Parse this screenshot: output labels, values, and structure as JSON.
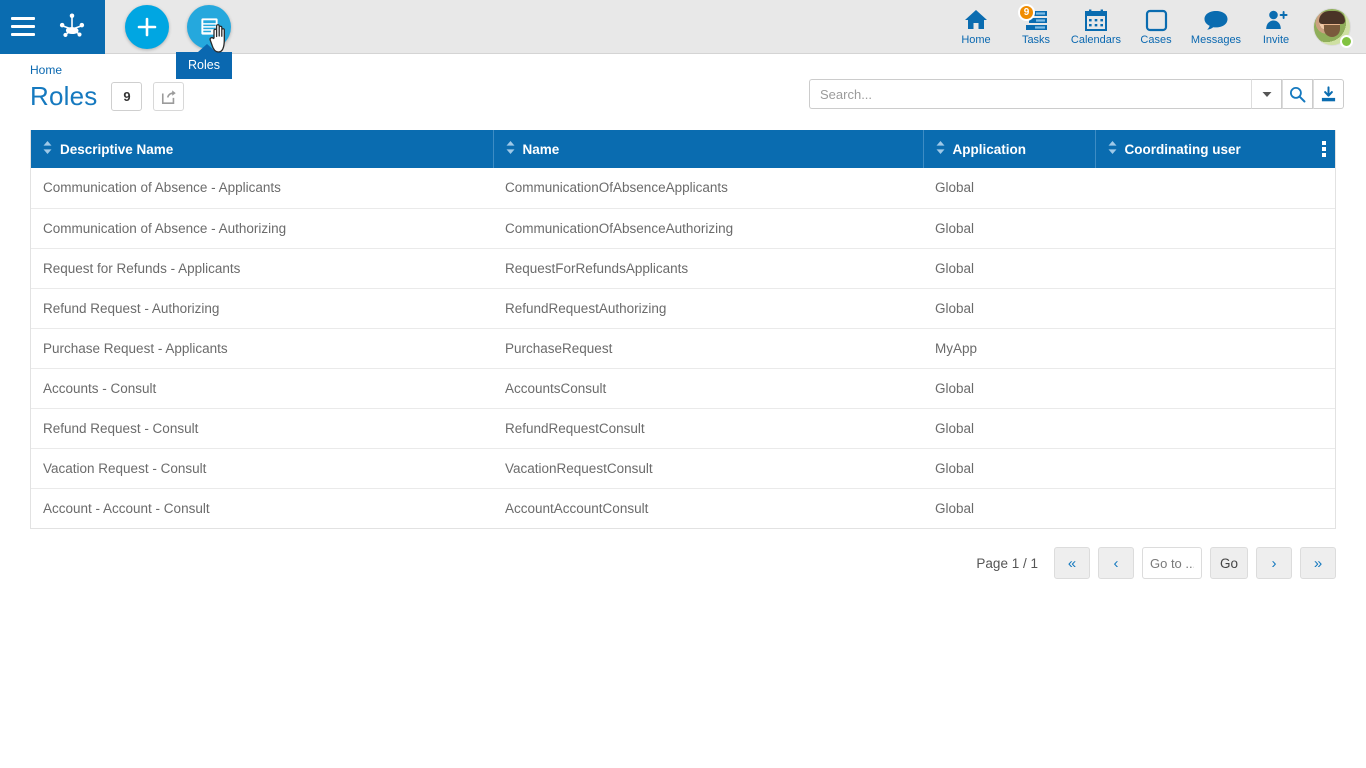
{
  "topbar": {
    "menu_icon": "hamburger-icon",
    "logo_icon": "bonita-frog-logo",
    "add_button_label": "+",
    "roles_button_icon": "list-document-icon",
    "tooltip_text": "Roles",
    "nav_items": [
      {
        "label": "Home",
        "icon": "home-icon",
        "badge": ""
      },
      {
        "label": "Tasks",
        "icon": "tasks-icon",
        "badge": "9"
      },
      {
        "label": "Calendars",
        "icon": "calendar-icon",
        "badge": ""
      },
      {
        "label": "Cases",
        "icon": "cases-icon",
        "badge": ""
      },
      {
        "label": "Messages",
        "icon": "message-icon",
        "badge": ""
      },
      {
        "label": "Invite",
        "icon": "invite-user-icon",
        "badge": ""
      }
    ],
    "avatar_status": "online"
  },
  "breadcrumb": {
    "home_label": "Home"
  },
  "page": {
    "title": "Roles",
    "count": "9",
    "export_icon": "share-export-icon"
  },
  "search": {
    "placeholder": "Search...",
    "value": "",
    "dropdown_icon": "chevron-down-icon",
    "search_icon": "magnifier-icon",
    "download_icon": "download-icon"
  },
  "table": {
    "columns": [
      {
        "label": "Descriptive Name",
        "sort_icon": "sort-updown-icon"
      },
      {
        "label": "Name",
        "sort_icon": "sort-updown-icon"
      },
      {
        "label": "Application",
        "sort_icon": "sort-updown-icon"
      },
      {
        "label": "Coordinating user",
        "sort_icon": "sort-updown-icon"
      }
    ],
    "menu_icon": "kebab-menu-icon",
    "rows": [
      {
        "descriptive_name": "Communication of Absence - Applicants",
        "name": "CommunicationOfAbsenceApplicants",
        "application": "Global",
        "coordinating_user": ""
      },
      {
        "descriptive_name": "Communication of Absence - Authorizing",
        "name": "CommunicationOfAbsenceAuthorizing",
        "application": "Global",
        "coordinating_user": ""
      },
      {
        "descriptive_name": "Request for Refunds - Applicants",
        "name": "RequestForRefundsApplicants",
        "application": "Global",
        "coordinating_user": ""
      },
      {
        "descriptive_name": "Refund Request - Authorizing",
        "name": "RefundRequestAuthorizing",
        "application": "Global",
        "coordinating_user": ""
      },
      {
        "descriptive_name": "Purchase Request - Applicants",
        "name": "PurchaseRequest",
        "application": "MyApp",
        "coordinating_user": ""
      },
      {
        "descriptive_name": "Accounts - Consult",
        "name": "AccountsConsult",
        "application": "Global",
        "coordinating_user": ""
      },
      {
        "descriptive_name": "Refund Request - Consult",
        "name": "RefundRequestConsult",
        "application": "Global",
        "coordinating_user": ""
      },
      {
        "descriptive_name": "Vacation Request - Consult",
        "name": "VacationRequestConsult",
        "application": "Global",
        "coordinating_user": ""
      },
      {
        "descriptive_name": "Account - Account - Consult",
        "name": "AccountAccountConsult",
        "application": "Global",
        "coordinating_user": ""
      }
    ]
  },
  "pagination": {
    "page_label": "Page 1 / 1",
    "first_label": "«",
    "prev_label": "‹",
    "goto_placeholder": "Go to ...",
    "goto_value": "",
    "go_label": "Go",
    "next_label": "›",
    "last_label": "»"
  },
  "colors": {
    "brand_blue": "#0a6cb0",
    "accent_cyan": "#00a6e2",
    "badge_orange": "#f08c00",
    "status_green": "#82c341",
    "link_blue": "#1579bf"
  }
}
